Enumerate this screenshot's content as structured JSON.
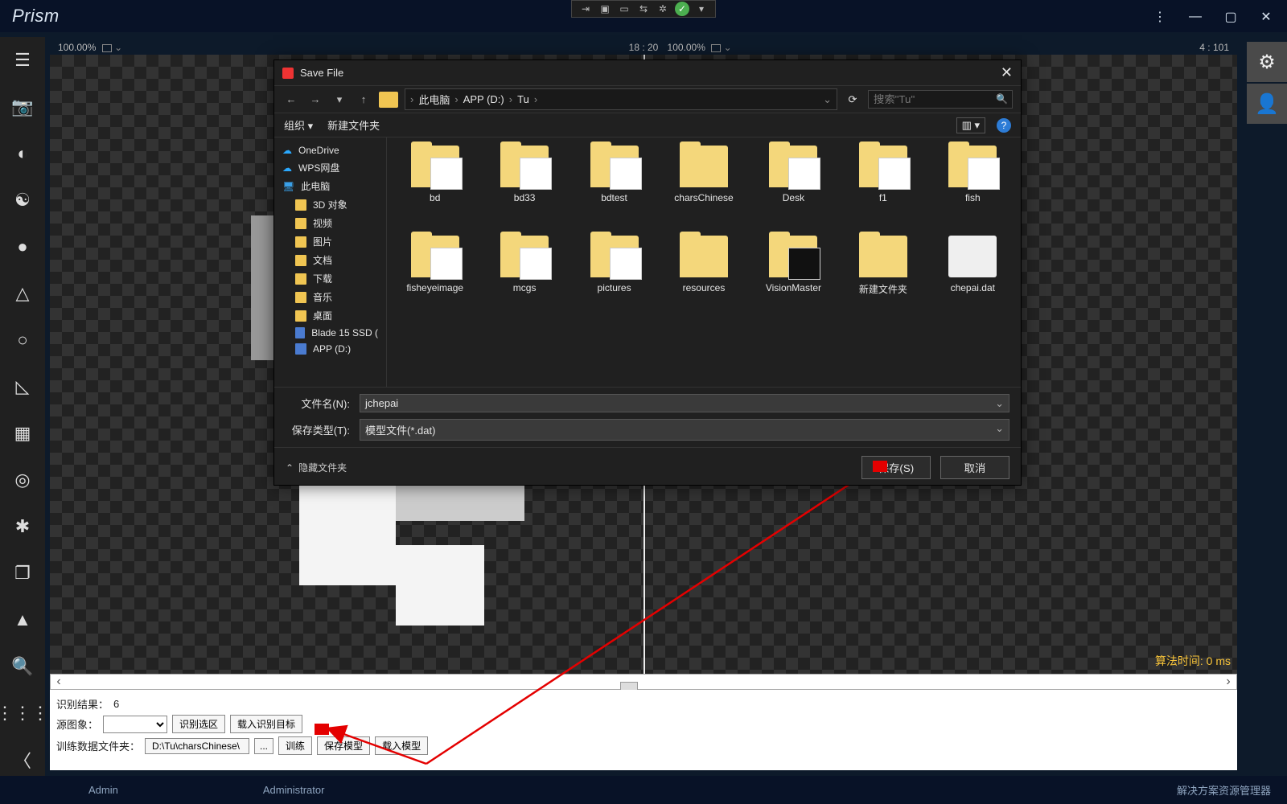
{
  "app": {
    "title": "Prism"
  },
  "window_controls": {
    "more": "⋮",
    "min": "—",
    "max": "▢",
    "close": "✕"
  },
  "float_toolbar": {
    "ok_glyph": "✓"
  },
  "right_tiles": {
    "gear": "⚙",
    "user": "👤"
  },
  "subbar": {
    "left_zoom": "100.00%",
    "mid": "18 : 20",
    "right_zoom": "100.00%",
    "right_ratio": "4 : 101"
  },
  "canvas": {
    "alg_time_label": "算法时间: 0 ms"
  },
  "bottom_panel": {
    "result_label": "识别结果：",
    "result_value": "6",
    "source_label": "源图象：",
    "btn_select_region": "识别选区",
    "btn_load_target": "载入识别目标",
    "train_folder_label": "训练数据文件夹：",
    "train_folder_value": "D:\\Tu\\charsChinese\\",
    "btn_ellipsis": "...",
    "btn_train": "训练",
    "btn_save_model": "保存模型",
    "btn_load_model": "载入模型"
  },
  "footer": {
    "c1": "Admin",
    "c2": "Administrator",
    "right": "解决方案资源管理器"
  },
  "save_dialog": {
    "title": "Save File",
    "close": "✕",
    "nav": {
      "back": "←",
      "fwd": "→",
      "dd": "▾",
      "up": "↑",
      "crumbs": [
        "此电脑",
        "APP (D:)",
        "Tu"
      ],
      "search_placeholder": "搜索\"Tu\""
    },
    "toolbar": {
      "organize": "组织 ▾",
      "newfolder": "新建文件夹",
      "help": "?"
    },
    "side": [
      {
        "icon": "cloud",
        "label": "OneDrive"
      },
      {
        "icon": "cloud",
        "label": "WPS网盘"
      },
      {
        "icon": "pc",
        "label": "此电脑"
      },
      {
        "icon": "folder",
        "label": "3D 对象",
        "indent": 1
      },
      {
        "icon": "folder",
        "label": "视频",
        "indent": 1
      },
      {
        "icon": "folder",
        "label": "图片",
        "indent": 1
      },
      {
        "icon": "folder",
        "label": "文档",
        "indent": 1
      },
      {
        "icon": "folder",
        "label": "下载",
        "indent": 1
      },
      {
        "icon": "folder",
        "label": "音乐",
        "indent": 1
      },
      {
        "icon": "folder",
        "label": "桌面",
        "indent": 1
      },
      {
        "icon": "drive",
        "label": "Blade 15 SSD (",
        "indent": 1
      },
      {
        "icon": "drive",
        "label": "APP (D:)",
        "indent": 1
      }
    ],
    "grid": [
      {
        "name": "bd",
        "type": "folder",
        "inner": true
      },
      {
        "name": "bd33",
        "type": "folder",
        "inner": true
      },
      {
        "name": "bdtest",
        "type": "folder",
        "inner": true
      },
      {
        "name": "charsChinese",
        "type": "folder"
      },
      {
        "name": "Desk",
        "type": "folder",
        "inner": true
      },
      {
        "name": "f1",
        "type": "folder",
        "inner": true
      },
      {
        "name": "fish",
        "type": "folder",
        "inner": true
      },
      {
        "name": "fisheyeimage",
        "type": "folder",
        "inner": true
      },
      {
        "name": "mcgs",
        "type": "folder",
        "inner": true
      },
      {
        "name": "pictures",
        "type": "folder",
        "inner": true
      },
      {
        "name": "resources",
        "type": "folder"
      },
      {
        "name": "VisionMaster",
        "type": "folder",
        "inner": true,
        "dark": true
      },
      {
        "name": "新建文件夹",
        "type": "folder"
      },
      {
        "name": "chepai.dat",
        "type": "file"
      }
    ],
    "fields": {
      "fname_label": "文件名(N):",
      "fname_value": "jchepai",
      "ftype_label": "保存类型(T):",
      "ftype_value": "模型文件(*.dat)"
    },
    "actions": {
      "hide_label": "隐藏文件夹",
      "save": "保存(S)",
      "cancel": "取消"
    }
  }
}
